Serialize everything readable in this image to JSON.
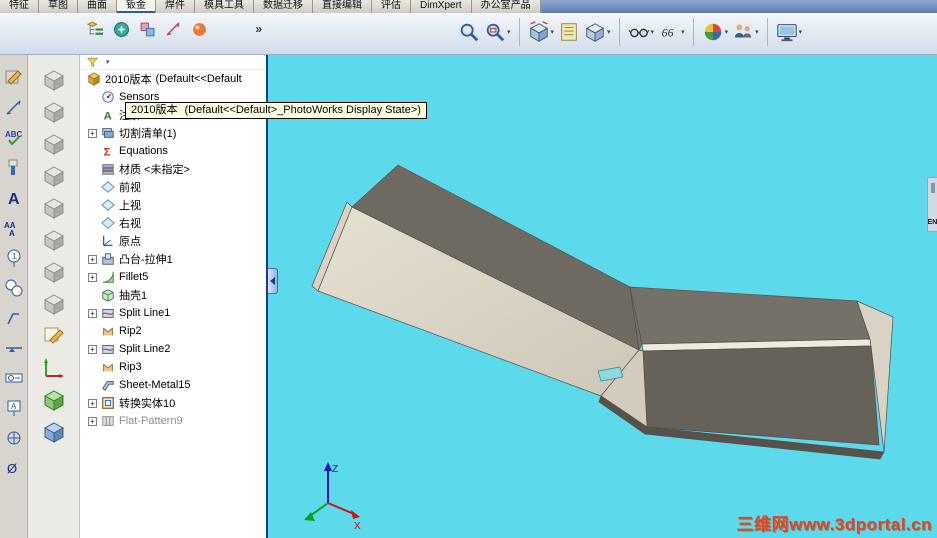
{
  "command_tabs": {
    "active": "钣金",
    "items": [
      {
        "label": "特征"
      },
      {
        "label": "草图"
      },
      {
        "label": "曲面"
      },
      {
        "label": "钣金"
      },
      {
        "label": "焊件"
      },
      {
        "label": "模具工具"
      },
      {
        "label": "数据迁移"
      },
      {
        "label": "直接编辑"
      },
      {
        "label": "评估"
      },
      {
        "label": "DimXpert"
      },
      {
        "label": "办公室产品"
      }
    ]
  },
  "panel_tabs": {
    "overflow_label": "»",
    "icons": [
      {
        "name": "featuremanager-tab-icon"
      },
      {
        "name": "propertymanager-tab-icon"
      },
      {
        "name": "configurationmanager-tab-icon"
      },
      {
        "name": "dimxpertmanager-tab-icon"
      },
      {
        "name": "displaymanager-tab-icon"
      }
    ]
  },
  "toolbar": {
    "icons": [
      {
        "name": "zoom-to-fit-icon",
        "dropdown": false
      },
      {
        "name": "zoom-to-area-icon",
        "dropdown": true
      },
      {
        "name": "view-orientation-icon",
        "dropdown": true
      },
      {
        "name": "section-view-icon",
        "dropdown": false
      },
      {
        "name": "display-style-icon",
        "dropdown": true
      },
      {
        "name": "hide-show-items-icon",
        "dropdown": true
      },
      {
        "name": "magnified-selection-icon",
        "dropdown": true
      },
      {
        "name": "edit-appearance-icon",
        "dropdown": true
      },
      {
        "name": "apply-scene-icon",
        "dropdown": true
      },
      {
        "name": "view-settings-icon",
        "dropdown": true
      }
    ]
  },
  "annotation_toolbar": {
    "icons": [
      {
        "name": "sketch-icon"
      },
      {
        "name": "smart-dimension-icon"
      },
      {
        "name": "spell-check-icon"
      },
      {
        "name": "format-painter-icon"
      },
      {
        "name": "note-icon"
      },
      {
        "name": "linear-note-pattern-icon"
      },
      {
        "name": "balloon-icon"
      },
      {
        "name": "auto-balloon-icon"
      },
      {
        "name": "surface-finish-icon"
      },
      {
        "name": "weld-symbol-icon"
      },
      {
        "name": "geometric-tolerance-icon"
      },
      {
        "name": "datum-feature-icon"
      },
      {
        "name": "datum-target-icon"
      },
      {
        "name": "hole-callout-icon"
      }
    ]
  },
  "feature_toolbar": {
    "icons": [
      {
        "name": "extruded-boss-icon",
        "state": "disabled"
      },
      {
        "name": "revolved-boss-icon",
        "state": "disabled"
      },
      {
        "name": "swept-boss-icon",
        "state": "disabled"
      },
      {
        "name": "lofted-boss-icon",
        "state": "disabled"
      },
      {
        "name": "extruded-cut-icon",
        "state": "disabled"
      },
      {
        "name": "revolved-cut-icon",
        "state": "disabled"
      },
      {
        "name": "fillet-feature-icon",
        "state": "disabled"
      },
      {
        "name": "linear-pattern-icon",
        "state": "disabled"
      },
      {
        "name": "sketch-pencil-icon",
        "state": "enabled"
      },
      {
        "name": "reference-geometry-icon",
        "state": "enabled"
      },
      {
        "name": "instant3d-icon",
        "state": "enabled"
      },
      {
        "name": "material-apply-icon",
        "state": "enabled"
      }
    ]
  },
  "feature_tree": {
    "root": {
      "label": "2010版本",
      "suffix": "(Default<<Default",
      "icon": "part-icon"
    },
    "items": [
      {
        "label": "Sensors",
        "icon": "sensors-icon",
        "expandable": false
      },
      {
        "label": "注解",
        "icon": "annotations-icon",
        "expandable": false
      },
      {
        "label": "切割清单(1)",
        "icon": "cutlist-icon",
        "expandable": true
      },
      {
        "label": "Equations",
        "icon": "equations-icon",
        "expandable": false
      },
      {
        "label": "材质 <未指定>",
        "icon": "material-icon",
        "expandable": false
      },
      {
        "label": "前视",
        "icon": "plane-icon",
        "expandable": false
      },
      {
        "label": "上视",
        "icon": "plane-icon",
        "expandable": false
      },
      {
        "label": "右视",
        "icon": "plane-icon",
        "expandable": false
      },
      {
        "label": "原点",
        "icon": "origin-icon",
        "expandable": false
      },
      {
        "label": "凸台-拉伸1",
        "icon": "boss-extrude-icon",
        "expandable": true
      },
      {
        "label": "Fillet5",
        "icon": "fillet-icon",
        "expandable": true
      },
      {
        "label": "抽壳1",
        "icon": "shell-icon",
        "expandable": false
      },
      {
        "label": "Split Line1",
        "icon": "split-line-icon",
        "expandable": true
      },
      {
        "label": "Rip2",
        "icon": "rip-icon",
        "expandable": false
      },
      {
        "label": "Split Line2",
        "icon": "split-line-icon",
        "expandable": true
      },
      {
        "label": "Rip3",
        "icon": "rip-icon",
        "expandable": false
      },
      {
        "label": "Sheet-Metal15",
        "icon": "sheet-metal-icon",
        "expandable": false
      },
      {
        "label": "转换实体10",
        "icon": "convert-entities-icon",
        "expandable": true
      },
      {
        "label": "Flat-Pattern9",
        "icon": "flat-pattern-icon",
        "expandable": true,
        "state": "suppressed"
      }
    ]
  },
  "tooltip": {
    "name": "2010版本",
    "text": "(Default<<Default>_PhotoWorks Display State>)"
  },
  "viewport": {
    "background_color": "#5CD9EB",
    "triad": {
      "z_label": "Z",
      "x_label": "X"
    },
    "watermark": "三维网www.3dportal.cn",
    "language_indicator": "EN"
  },
  "model": {
    "name": "bent-sheet-metal-part",
    "colors": {
      "top_dark": "#6E6A62",
      "top_dark2": "#757168",
      "front_dark": "#666259",
      "web_light_1": "#E6E0D2",
      "web_light_2": "#CEC7B7",
      "bend_light": "#D3CCBD",
      "end_cap": "#DAD3C4",
      "bottom_dark": "#55514B",
      "highlight": "#EFEADF",
      "selection_teal": "#8FD9DE"
    }
  }
}
